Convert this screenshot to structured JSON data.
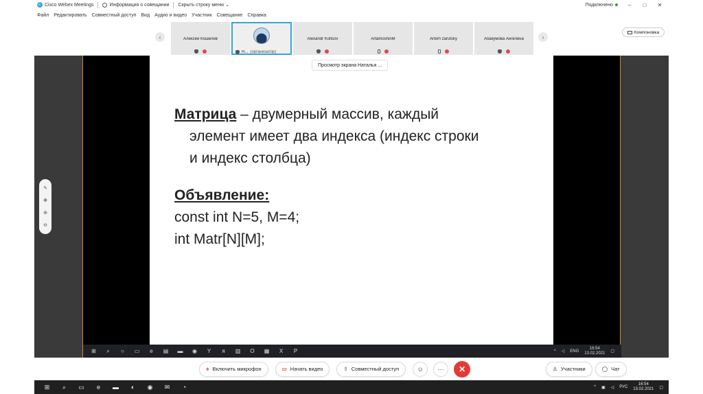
{
  "window": {
    "app_title": "Cisco Webex Meetings",
    "meeting_info": "Информация о совещании",
    "hide_menu": "Скрыть строку меню",
    "hide_menu_chevron": "⌄",
    "connection_status": "Подключено",
    "status_color": "#2ea043"
  },
  "menu": {
    "items": [
      "Файл",
      "Редактировать",
      "Совместный доступ",
      "Вид",
      "Аудио и видео",
      "Участник",
      "Совещание",
      "Справка"
    ]
  },
  "participants": [
    {
      "name": "Алексей Кошелев"
    },
    {
      "name": "Н...",
      "role": "(организатор)",
      "is_host": true
    },
    {
      "name": "Alexandr Koltsov"
    },
    {
      "name": "ArtamoshinM"
    },
    {
      "name": "Artem zarutsky"
    },
    {
      "name": "Абакумова Ангелина"
    }
  ],
  "layout_button": "Компоновка",
  "share": {
    "viewer_label": "Просмотр экрана Наталья ...",
    "slide": {
      "term": "Матрица",
      "line1_rest": " – двумерный массив, каждый",
      "line2": "элемент имеет два индекса  (индекс строки",
      "line3": "и индекс столбца)",
      "heading": "Объявление:",
      "code1": "const int N=5, M=4;",
      "code2": "int Matr[N][M];"
    },
    "taskbar": {
      "lang": "ENG",
      "time": "16:54",
      "date": "13.02.2021"
    }
  },
  "controls": {
    "mute": "Включить микрофон",
    "video": "Начать видео",
    "share": "Совместный доступ",
    "participants": "Участники",
    "chat": "Чат"
  },
  "taskbar": {
    "lang": "РУС",
    "time": "16:54",
    "date": "13.02.2021"
  },
  "colors": {
    "accent": "#2aa9e0",
    "leave": "#e53935",
    "share_border": "#d9822b"
  }
}
